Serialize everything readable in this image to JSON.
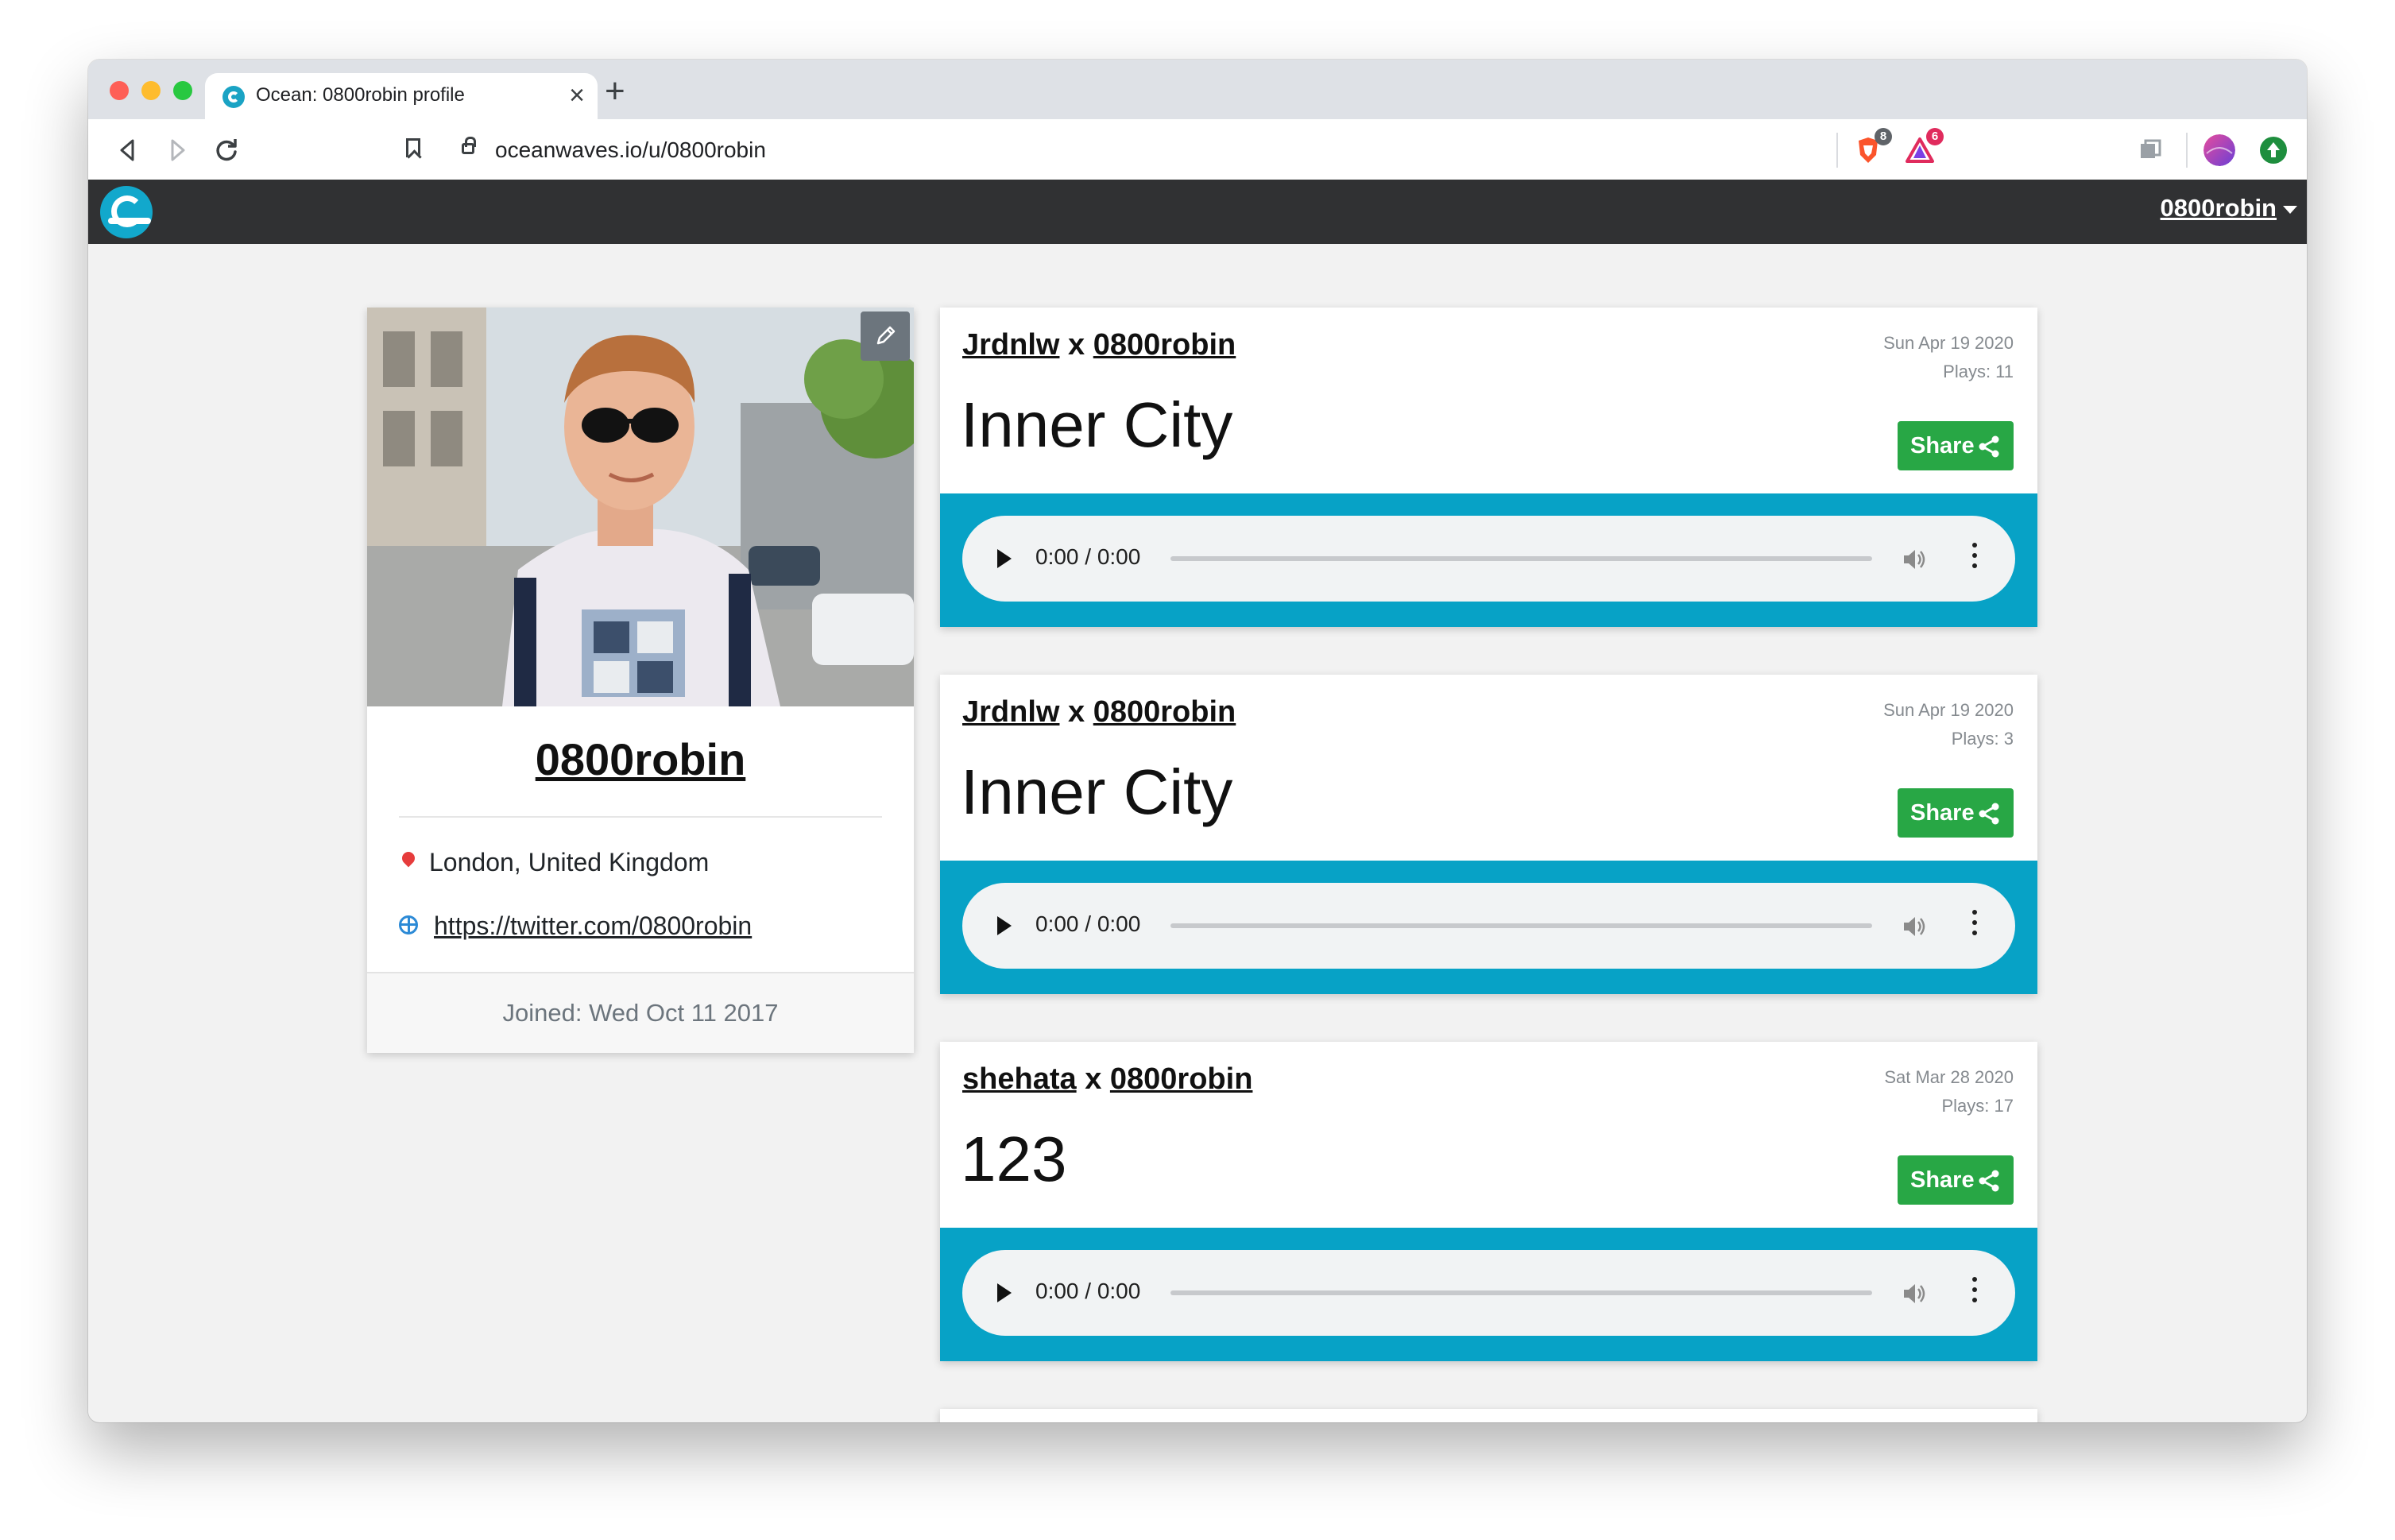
{
  "browser": {
    "tab_title": "Ocean: 0800robin profile",
    "tab_close": "×",
    "new_tab": "+",
    "url": "oceanwaves.io/u/0800robin",
    "extensions": [
      {
        "name": "brave-shields-icon",
        "badge": "8",
        "color": "#fb542b"
      },
      {
        "name": "brave-rewards-icon",
        "badge": "6",
        "color": "#e02b5d"
      }
    ]
  },
  "site": {
    "user_menu_label": "0800robin"
  },
  "profile": {
    "username": "0800robin",
    "location": "London, United Kingdom",
    "website": "https://twitter.com/0800robin",
    "joined": "Joined: Wed Oct 11 2017"
  },
  "tracks": [
    {
      "artist_a": "Jrdnlw",
      "separator": "x",
      "artist_b": "0800robin",
      "date": "Sun Apr 19 2020",
      "plays": "Plays: 11",
      "title": "Inner City",
      "share_label": "Share",
      "time": "0:00 / 0:00"
    },
    {
      "artist_a": "Jrdnlw",
      "separator": "x",
      "artist_b": "0800robin",
      "date": "Sun Apr 19 2020",
      "plays": "Plays: 3",
      "title": "Inner City",
      "share_label": "Share",
      "time": "0:00 / 0:00"
    },
    {
      "artist_a": "shehata",
      "separator": "x",
      "artist_b": "0800robin",
      "date": "Sat Mar 28 2020",
      "plays": "Plays: 17",
      "title": "123",
      "share_label": "Share",
      "time": "0:00 / 0:00"
    }
  ],
  "colors": {
    "navbar": "#303133",
    "player_band": "#07a2c6",
    "share_button": "#28a745",
    "page_bg": "#f2f2f2"
  }
}
